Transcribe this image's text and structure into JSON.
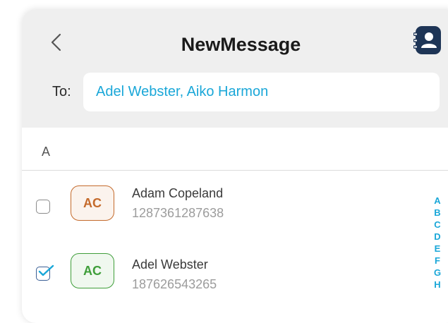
{
  "header": {
    "title": "NewMessage",
    "back_icon": "chevron-left-icon",
    "contacts_icon": "contacts-book-icon"
  },
  "to": {
    "label": "To:",
    "value": "Adel Webster, Aiko Harmon"
  },
  "section": {
    "letter": "A"
  },
  "contacts": [
    {
      "initials": "AC",
      "name": "Adam Copeland",
      "phone": "1287361287638",
      "checked": false,
      "accent": "#c46a2b",
      "tint": "#fbf3ed"
    },
    {
      "initials": "AC",
      "name": "Adel Webster",
      "phone": "187626543265",
      "checked": true,
      "accent": "#3f9e3a",
      "tint": "#f0f8ef"
    }
  ],
  "alpha_index": [
    "A",
    "B",
    "C",
    "D",
    "E",
    "F",
    "G",
    "H"
  ],
  "colors": {
    "accent_blue": "#1aa7d8",
    "header_bg": "#efefef",
    "contacts_icon_bg": "#1e3556"
  }
}
